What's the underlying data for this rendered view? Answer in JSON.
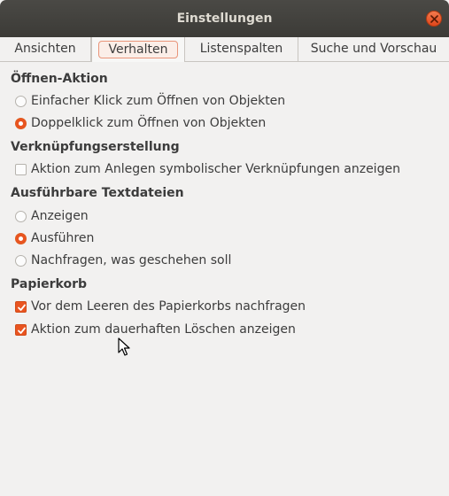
{
  "window": {
    "title": "Einstellungen"
  },
  "tabs": [
    {
      "label": "Ansichten"
    },
    {
      "label": "Verhalten"
    },
    {
      "label": "Listenspalten"
    },
    {
      "label": "Suche und Vorschau"
    }
  ],
  "sections": {
    "open_action": {
      "title": "Öffnen-Aktion",
      "options": [
        {
          "label": "Einfacher Klick zum Öffnen von Objekten",
          "checked": false
        },
        {
          "label": "Doppelklick zum Öffnen von Objekten",
          "checked": true
        }
      ]
    },
    "link_creation": {
      "title": "Verknüpfungserstellung",
      "options": [
        {
          "label": "Aktion zum Anlegen symbolischer Verknüpfungen anzeigen",
          "checked": false
        }
      ]
    },
    "executable_text": {
      "title": "Ausführbare Textdateien",
      "options": [
        {
          "label": "Anzeigen",
          "checked": false
        },
        {
          "label": "Ausführen",
          "checked": true
        },
        {
          "label": "Nachfragen, was geschehen soll",
          "checked": false
        }
      ]
    },
    "trash": {
      "title": "Papierkorb",
      "options": [
        {
          "label": "Vor dem Leeren des Papierkorbs nachfragen",
          "checked": true
        },
        {
          "label": "Aktion zum dauerhaften Löschen anzeigen",
          "checked": true
        }
      ]
    }
  },
  "colors": {
    "accent": "#e95420",
    "titlebar": "#3c3b37",
    "background": "#f2f1f0"
  }
}
